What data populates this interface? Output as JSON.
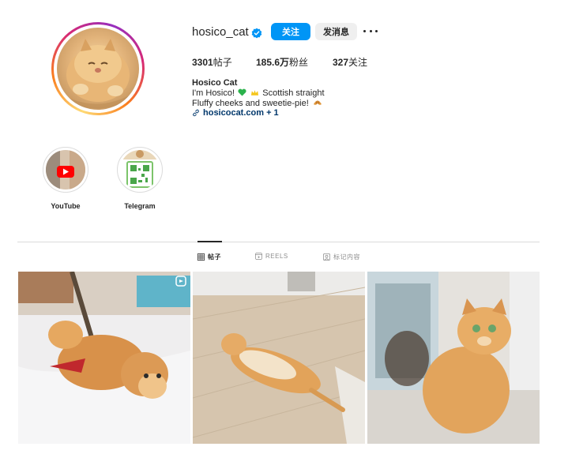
{
  "profile": {
    "username": "hosico_cat",
    "verified": true,
    "follow_label": "关注",
    "message_label": "发消息",
    "more_icon": "more-dots-icon"
  },
  "stats": {
    "posts_value": "3301",
    "posts_label": "帖子",
    "followers_value": "185.6万",
    "followers_label": "粉丝",
    "following_value": "327",
    "following_label": "关注"
  },
  "bio": {
    "name": "Hosico Cat",
    "line1_pre": "I'm Hosico!",
    "line1_post": "Scottish straight",
    "line2": "Fluffy cheeks and sweetie-pie!",
    "link": "hosicocat.com + 1"
  },
  "highlights": [
    {
      "label": "YouTube"
    },
    {
      "label": "Telegram"
    }
  ],
  "tabs": [
    {
      "label": "帖子",
      "icon": "grid-icon",
      "active": true
    },
    {
      "label": "REELS",
      "icon": "reels-icon",
      "active": false
    },
    {
      "label": "标记内容",
      "icon": "tagged-icon",
      "active": false
    }
  ],
  "colors": {
    "primary": "#0095f6",
    "text": "#262626",
    "secondary_text": "#8e8e8e",
    "link": "#00376b",
    "verified": "#0095f6"
  }
}
